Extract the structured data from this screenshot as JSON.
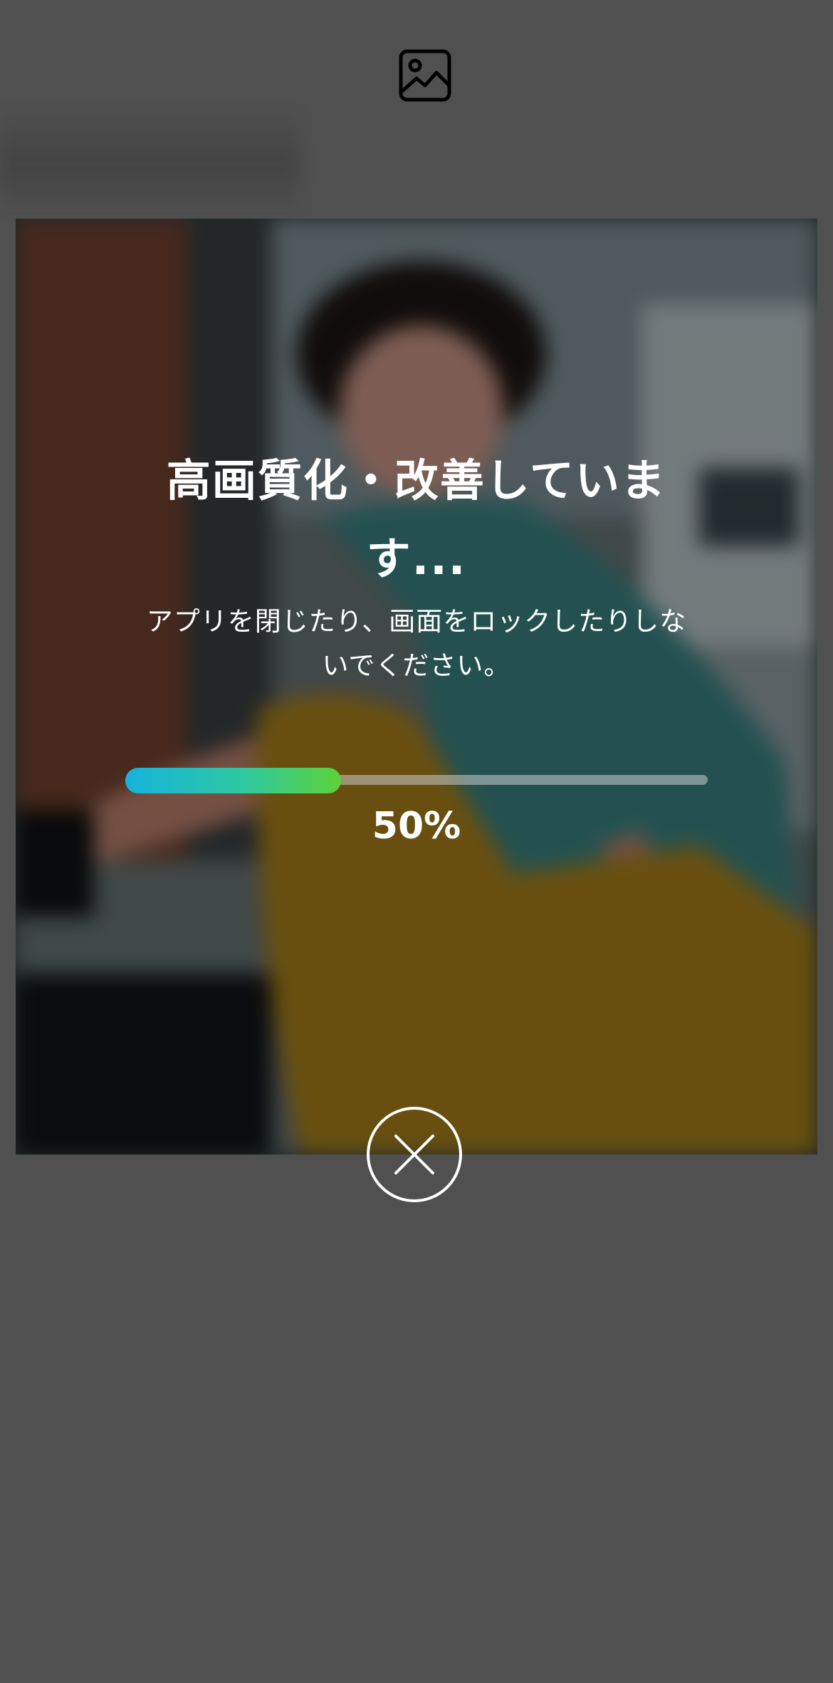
{
  "header": {
    "icon": "image-icon"
  },
  "processing": {
    "title": "高画質化・改善していま\nす...",
    "subtitle": "アプリを閉じたり、画面をロックしたりしな\nいでください。",
    "progress_fraction": 0.37,
    "progress_label": "50%"
  },
  "actions": {
    "close_icon": "close-icon"
  },
  "colors": {
    "background": "#505050",
    "progress_start": "#15b3dc",
    "progress_end": "#5cd23a",
    "text": "#ffffff"
  }
}
